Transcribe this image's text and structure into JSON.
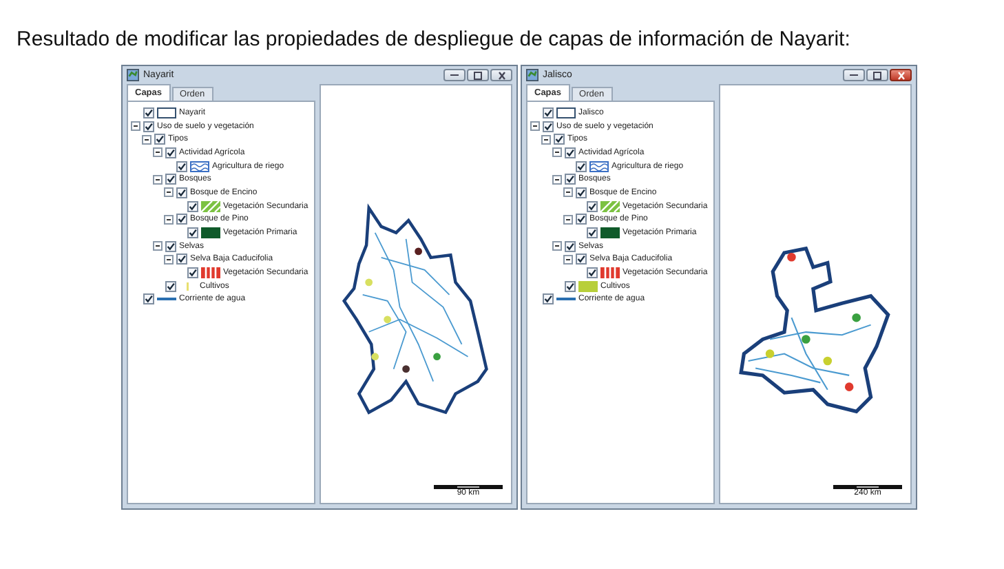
{
  "heading": "Resultado de modificar las propiedades de despliegue de capas de información de Nayarit:",
  "windows": [
    {
      "title": "Nayarit",
      "active": false,
      "tabs": [
        {
          "label": "Capas",
          "selected": true
        },
        {
          "label": "Orden",
          "selected": false
        }
      ],
      "scale_label": "90 km",
      "tree": [
        {
          "label": "Nayarit",
          "checked": true,
          "swatch": {
            "kind": "box",
            "color": "#34506e"
          }
        },
        {
          "label": "Uso de suelo y vegetación",
          "checked": true,
          "expanded": true,
          "children": [
            {
              "label": "Tipos",
              "checked": true,
              "expanded": true,
              "children": [
                {
                  "label": "Actividad Agrícola",
                  "checked": true,
                  "expanded": true,
                  "children": [
                    {
                      "label": "Agricultura de riego",
                      "checked": true,
                      "swatch": {
                        "kind": "pattern",
                        "color": "#3a6fc4"
                      }
                    }
                  ]
                },
                {
                  "label": "Bosques",
                  "checked": true,
                  "expanded": true,
                  "children": [
                    {
                      "label": "Bosque de Encino",
                      "checked": true,
                      "expanded": true,
                      "children": [
                        {
                          "label": "Vegetación Secundaria",
                          "checked": true,
                          "swatch": {
                            "kind": "hatch",
                            "color": "#7cc242"
                          }
                        }
                      ]
                    },
                    {
                      "label": "Bosque de Pino",
                      "checked": true,
                      "expanded": true,
                      "children": [
                        {
                          "label": "Vegetación Primaria",
                          "checked": true,
                          "swatch": {
                            "kind": "fill",
                            "color": "#0f5a2a"
                          }
                        }
                      ]
                    }
                  ]
                },
                {
                  "label": "Selvas",
                  "checked": true,
                  "expanded": true,
                  "children": [
                    {
                      "label": "Selva Baja Caducifolia",
                      "checked": true,
                      "expanded": true,
                      "children": [
                        {
                          "label": "Vegetación Secundaria",
                          "checked": true,
                          "swatch": {
                            "kind": "stripes",
                            "color": "#e03a2e"
                          }
                        }
                      ]
                    }
                  ]
                },
                {
                  "label": "Cultivos",
                  "checked": true,
                  "swatch": {
                    "kind": "sliver",
                    "color": "#e8e070"
                  }
                }
              ]
            }
          ]
        },
        {
          "label": "Corriente de agua",
          "checked": true,
          "swatch": {
            "kind": "line",
            "color": "#2a6fb0"
          }
        }
      ]
    },
    {
      "title": "Jalisco",
      "active": true,
      "tabs": [
        {
          "label": "Capas",
          "selected": true
        },
        {
          "label": "Orden",
          "selected": false
        }
      ],
      "scale_label": "240 km",
      "tree": [
        {
          "label": "Jalisco",
          "checked": true,
          "swatch": {
            "kind": "box",
            "color": "#34506e"
          }
        },
        {
          "label": "Uso de suelo y vegetación",
          "checked": true,
          "expanded": true,
          "children": [
            {
              "label": "Tipos",
              "checked": true,
              "expanded": true,
              "children": [
                {
                  "label": "Actividad Agrícola",
                  "checked": true,
                  "expanded": true,
                  "children": [
                    {
                      "label": "Agricultura de riego",
                      "checked": true,
                      "swatch": {
                        "kind": "pattern",
                        "color": "#3a6fc4"
                      }
                    }
                  ]
                },
                {
                  "label": "Bosques",
                  "checked": true,
                  "expanded": true,
                  "children": [
                    {
                      "label": "Bosque de Encino",
                      "checked": true,
                      "expanded": true,
                      "children": [
                        {
                          "label": "Vegetación Secundaria",
                          "checked": true,
                          "swatch": {
                            "kind": "hatch",
                            "color": "#7cc242"
                          }
                        }
                      ]
                    },
                    {
                      "label": "Bosque de Pino",
                      "checked": true,
                      "expanded": true,
                      "children": [
                        {
                          "label": "Vegetación Primaria",
                          "checked": true,
                          "swatch": {
                            "kind": "fill",
                            "color": "#0f5a2a"
                          }
                        }
                      ]
                    }
                  ]
                },
                {
                  "label": "Selvas",
                  "checked": true,
                  "expanded": true,
                  "children": [
                    {
                      "label": "Selva Baja Caducifolia",
                      "checked": true,
                      "expanded": true,
                      "children": [
                        {
                          "label": "Vegetación Secundaria",
                          "checked": true,
                          "swatch": {
                            "kind": "stripes",
                            "color": "#e03a2e"
                          }
                        }
                      ]
                    }
                  ]
                },
                {
                  "label": "Cultivos",
                  "checked": true,
                  "swatch": {
                    "kind": "fill",
                    "color": "#b8cf3a"
                  }
                }
              ]
            }
          ]
        },
        {
          "label": "Corriente de agua",
          "checked": true,
          "swatch": {
            "kind": "line",
            "color": "#2a6fb0"
          }
        }
      ]
    }
  ]
}
